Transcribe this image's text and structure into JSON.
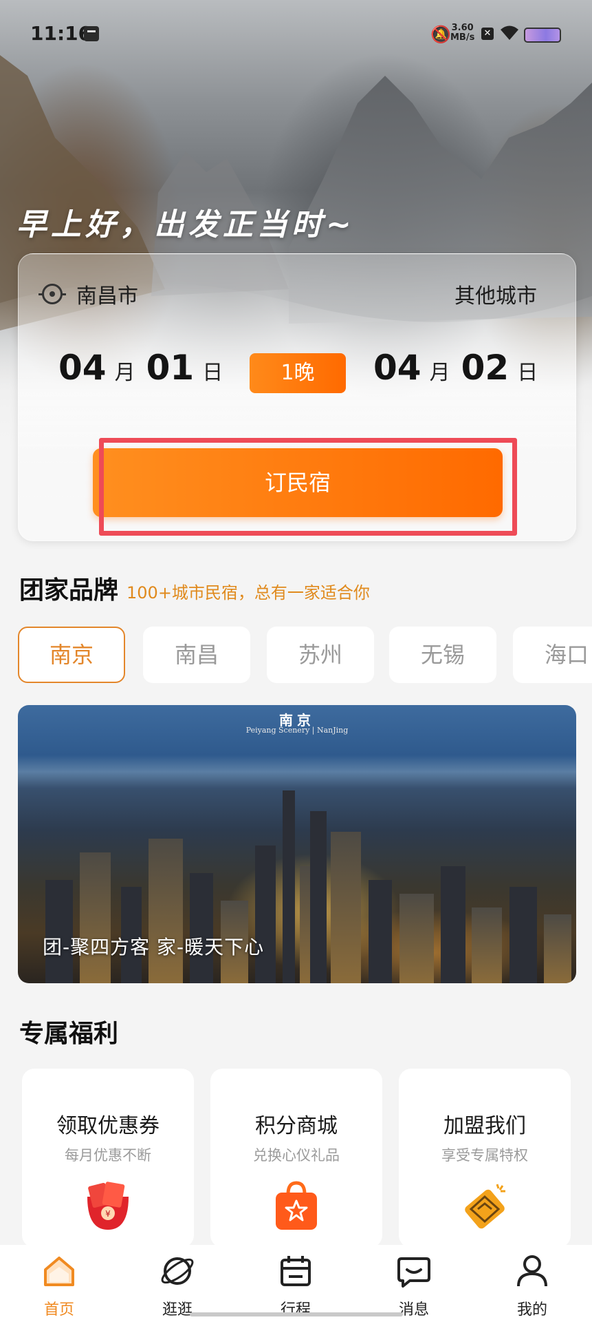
{
  "status_bar": {
    "time": "11:16",
    "net_speed_value": "3.60",
    "net_speed_unit": "MB/s"
  },
  "hero": {
    "greeting": "早上好，出发正当时~"
  },
  "booking": {
    "current_city": "南昌市",
    "other_city": "其他城市",
    "check_in": {
      "month": "04",
      "month_unit": "月",
      "day": "01",
      "day_unit": "日"
    },
    "check_out": {
      "month": "04",
      "month_unit": "月",
      "day": "02",
      "day_unit": "日"
    },
    "nights": "1晚",
    "book_button": "订民宿"
  },
  "brand": {
    "title": "团家品牌",
    "subtitle": "100+城市民宿，总有一家适合你",
    "cities": [
      "南京",
      "南昌",
      "苏州",
      "无锡",
      "海口"
    ],
    "active_city": "南京",
    "banner": {
      "logo": "南京",
      "logo_sub": "Peiyang Scenery | NanJing",
      "caption": "团-聚四方客  家-暖天下心"
    }
  },
  "benefits": {
    "title": "专属福利",
    "cards": [
      {
        "title": "领取优惠券",
        "subtitle": "每月优惠不断",
        "icon": "red-envelope-icon"
      },
      {
        "title": "积分商城",
        "subtitle": "兑换心仪礼品",
        "icon": "shopping-bag-star-icon"
      },
      {
        "title": "加盟我们",
        "subtitle": "享受专属特权",
        "icon": "handshake-icon"
      }
    ]
  },
  "tabbar": {
    "items": [
      {
        "label": "首页",
        "icon": "home-icon",
        "active": true
      },
      {
        "label": "逛逛",
        "icon": "planet-icon"
      },
      {
        "label": "行程",
        "icon": "calendar-icon"
      },
      {
        "label": "消息",
        "icon": "message-icon"
      },
      {
        "label": "我的",
        "icon": "profile-icon"
      }
    ]
  },
  "colors": {
    "accent": "#ff7a0f",
    "accent_text": "#e3862a",
    "highlight": "#ee4b57"
  }
}
